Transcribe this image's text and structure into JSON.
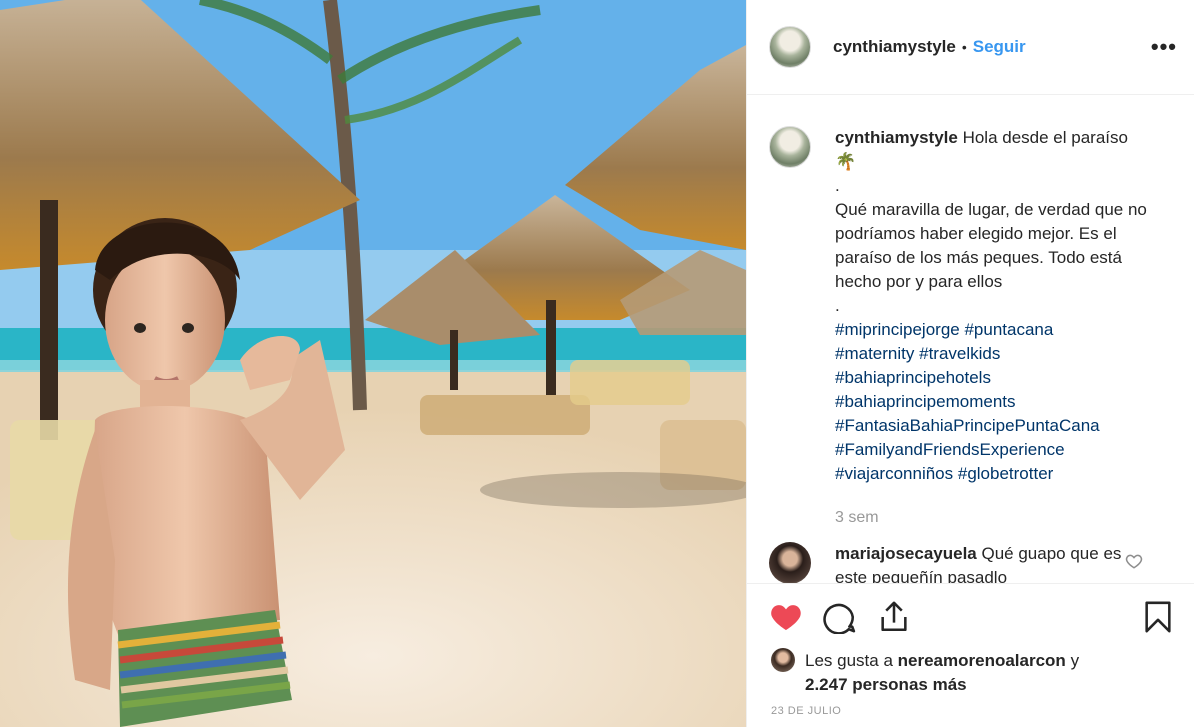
{
  "post": {
    "username": "cynthiamystyle",
    "separator": "•",
    "follow_label": "Seguir",
    "more_icon": "more-options-icon",
    "more_label": "•••"
  },
  "caption": {
    "username": "cynthiamystyle",
    "line1": "Hola desde el paraíso",
    "emoji": "🌴",
    "dot1": ".",
    "body": "Qué maravilla de lugar, de verdad que no podríamos haber elegido mejor. Es el paraíso de los más peques. Todo está hecho por y para ellos",
    "dot2": ".",
    "hashtags": [
      "#miprincipejorge",
      "#puntacana",
      "#maternity",
      "#travelkids",
      "#bahiaprincipehotels",
      "#bahiaprincipemoments",
      "#FantasiaBahiaPrincipePuntaCana",
      "#FamilyandFriendsExperience",
      "#viajarconniños",
      "#globetrotter"
    ],
    "time": "3 sem"
  },
  "comments": [
    {
      "username": "mariajosecayuela",
      "text": "Qué guapo que es este pequeñín pasadlo"
    }
  ],
  "likes": {
    "prefix": "Les gusta a",
    "user": "nereamorenoalarcon",
    "conj": "y",
    "others": "2.247 personas más"
  },
  "date": "23 DE JULIO",
  "colors": {
    "follow": "#3897f0",
    "hashtag": "#003569",
    "like_active": "#ed4956",
    "muted": "#999999"
  }
}
